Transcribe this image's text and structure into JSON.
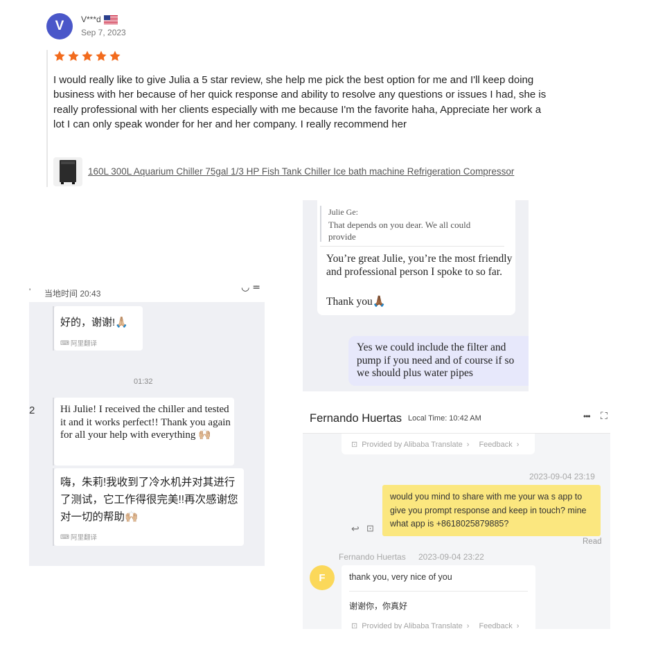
{
  "review": {
    "avatar_letter": "V",
    "reviewer": "V***d",
    "date": "Sep 7, 2023",
    "rating": 5,
    "star_color": "#f26b1d",
    "text": "I would really like to give Julia a 5 star review, she help me pick the best option for me and I'll keep doing business with her because of her quick response and ability to resolve any questions or issues I had, she is really professional with her clients especially with me because I'm the favorite haha, Appreciate her work a lot I can only speak wonder for her and her company. I really recommend her",
    "product": "160L 300L Aquarium Chiller 75gal 1/3 HP Fish Tank Chiller Ice bath machine Refrigeration Compressor"
  },
  "chat_left": {
    "header_time": "当地时间 20:43",
    "header_icons": "◡  ≗",
    "msg1": "好的，谢谢!🙏🏼",
    "translate_label": "阿里翻译",
    "timestamp": "01:32",
    "side_num": "2",
    "msg2": "Hi Julie! I received the chiller and tested it and it works perfect!! Thank you again for all your help with everything 🙌🏼",
    "msg2_translation": "嗨，朱莉!我收到了冷水机并对其进行了测试，它工作得很完美!!再次感谢您对一切的帮助🙌🏼",
    "translate_label2": "阿里翻译"
  },
  "chat_top_right": {
    "quote_name": "Julie Ge:",
    "quote_text": "That depends on you dear. We all could provide",
    "reply_line1": "You’re great Julie, you’re the most friendly and professional person I spoke to so far.",
    "reply_line2": "Thank you🙏🏾",
    "outgoing": "Yes we could include the filter and pump if you need and of course if so we should plus water pipes",
    "outgoing_bg": "#e7e8fb"
  },
  "chat_bottom_right": {
    "contact_name": "Fernando Huertas",
    "local_time": "Local Time: 10:42 AM",
    "more_icon": "•••",
    "expand_icon": "⛶",
    "provided_by": "Provided by Alibaba Translate",
    "feedback": "Feedback",
    "out_timestamp": "2023-09-04 23:19",
    "outgoing": "would you mind to share with me your wa s app to give you prompt response and keep in touch? mine what app is +8618025879885?",
    "outgoing_bg": "#fbe77f",
    "read_label": "Read",
    "in_sender": "Fernando Huertas",
    "in_timestamp": "2023-09-04 23:22",
    "in_avatar_letter": "F",
    "in_avatar_color": "#fbd85a",
    "incoming": "thank you, very nice of you",
    "incoming_translation": "谢谢你，你真好",
    "provided_by2": "Provided by Alibaba Translate",
    "feedback2": "Feedback"
  }
}
